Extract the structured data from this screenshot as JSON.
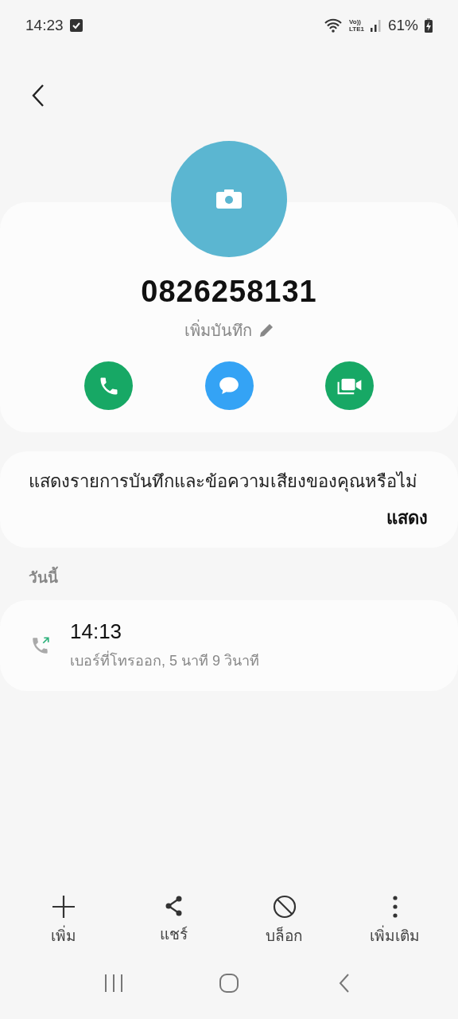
{
  "status_bar": {
    "time": "14:23",
    "volte": "Vo))",
    "network": "LTE1",
    "battery": "61%",
    "charging": true
  },
  "contact": {
    "number": "0826258131",
    "note_label": "เพิ่มบันทึก"
  },
  "actions": [
    {
      "kind": "call",
      "color": "#17a865"
    },
    {
      "kind": "message",
      "color": "#34a3f5"
    },
    {
      "kind": "video",
      "color": "#17a865"
    }
  ],
  "prompt": {
    "text": "แสดงรายการบันทึกและข้อความเสียงของคุณหรือไม่",
    "action": "แสดง"
  },
  "history": {
    "heading": "วันนี้",
    "entries": [
      {
        "kind": "outgoing",
        "time": "14:13",
        "detail": "เบอร์ที่โทรออก, 5 นาที 9 วินาที"
      }
    ]
  },
  "toolbar": [
    {
      "kind": "add",
      "label": "เพิ่ม"
    },
    {
      "kind": "share",
      "label": "แชร์"
    },
    {
      "kind": "block",
      "label": "บล็อก"
    },
    {
      "kind": "more",
      "label": "เพิ่มเติม"
    }
  ]
}
